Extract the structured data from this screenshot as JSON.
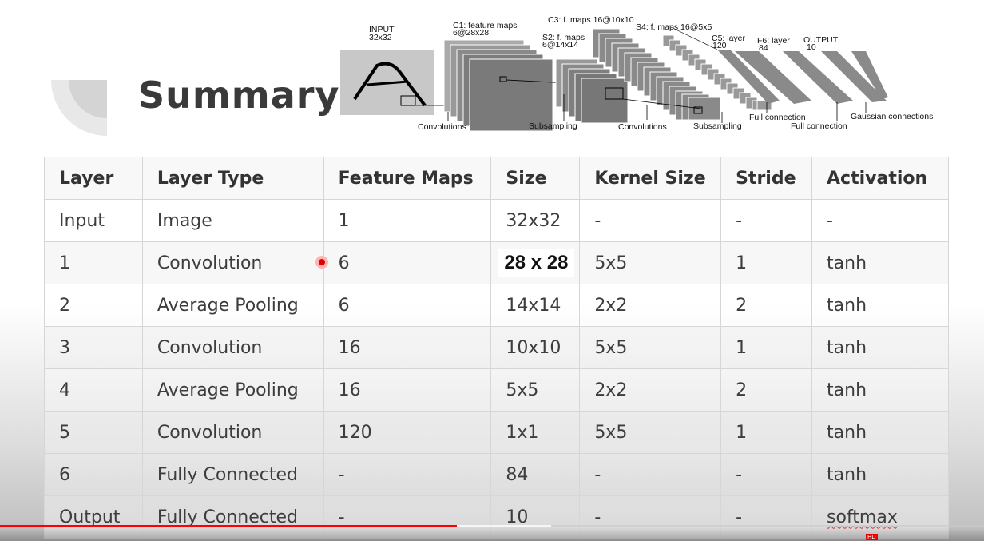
{
  "slide": {
    "title": "Summary",
    "architecture_labels": {
      "input": "INPUT",
      "input_size": "32x32",
      "c1": "C1: feature maps",
      "c1_size": "6@28x28",
      "s2": "S2: f. maps",
      "s2_size": "6@14x14",
      "c3": "C3: f. maps 16@10x10",
      "s4": "S4: f. maps 16@5x5",
      "c5": "C5: layer",
      "c5_size": "120",
      "f6": "F6: layer",
      "f6_size": "84",
      "output": "OUTPUT",
      "output_size": "10",
      "conv1": "Convolutions",
      "sub1": "Subsampling",
      "conv2": "Convolutions",
      "sub2": "Subsampling",
      "full1": "Full connection",
      "full2": "Full connection",
      "gauss": "Gaussian connections"
    }
  },
  "table": {
    "headers": [
      "Layer",
      "Layer Type",
      "Feature Maps",
      "Size",
      "Kernel Size",
      "Stride",
      "Activation"
    ],
    "rows": [
      [
        "Input",
        "Image",
        "1",
        "32x32",
        "-",
        "-",
        "-"
      ],
      [
        "1",
        "Convolution",
        "6",
        "28 x 28",
        "5x5",
        "1",
        "tanh"
      ],
      [
        "2",
        "Average Pooling",
        "6",
        "14x14",
        "2x2",
        "2",
        "tanh"
      ],
      [
        "3",
        "Convolution",
        "16",
        "10x10",
        "5x5",
        "1",
        "tanh"
      ],
      [
        "4",
        "Average Pooling",
        "16",
        "5x5",
        "2x2",
        "2",
        "tanh"
      ],
      [
        "5",
        "Convolution",
        "120",
        "1x1",
        "5x5",
        "1",
        "tanh"
      ],
      [
        "6",
        "Fully Connected",
        "-",
        "84",
        "-",
        "-",
        "tanh"
      ],
      [
        "Output",
        "Fully Connected",
        "-",
        "10",
        "-",
        "-",
        "softmax"
      ]
    ]
  },
  "player": {
    "progress": 0.464,
    "buffered": 0.56,
    "progress_color": "#ff0000",
    "hd_label": "HD"
  }
}
